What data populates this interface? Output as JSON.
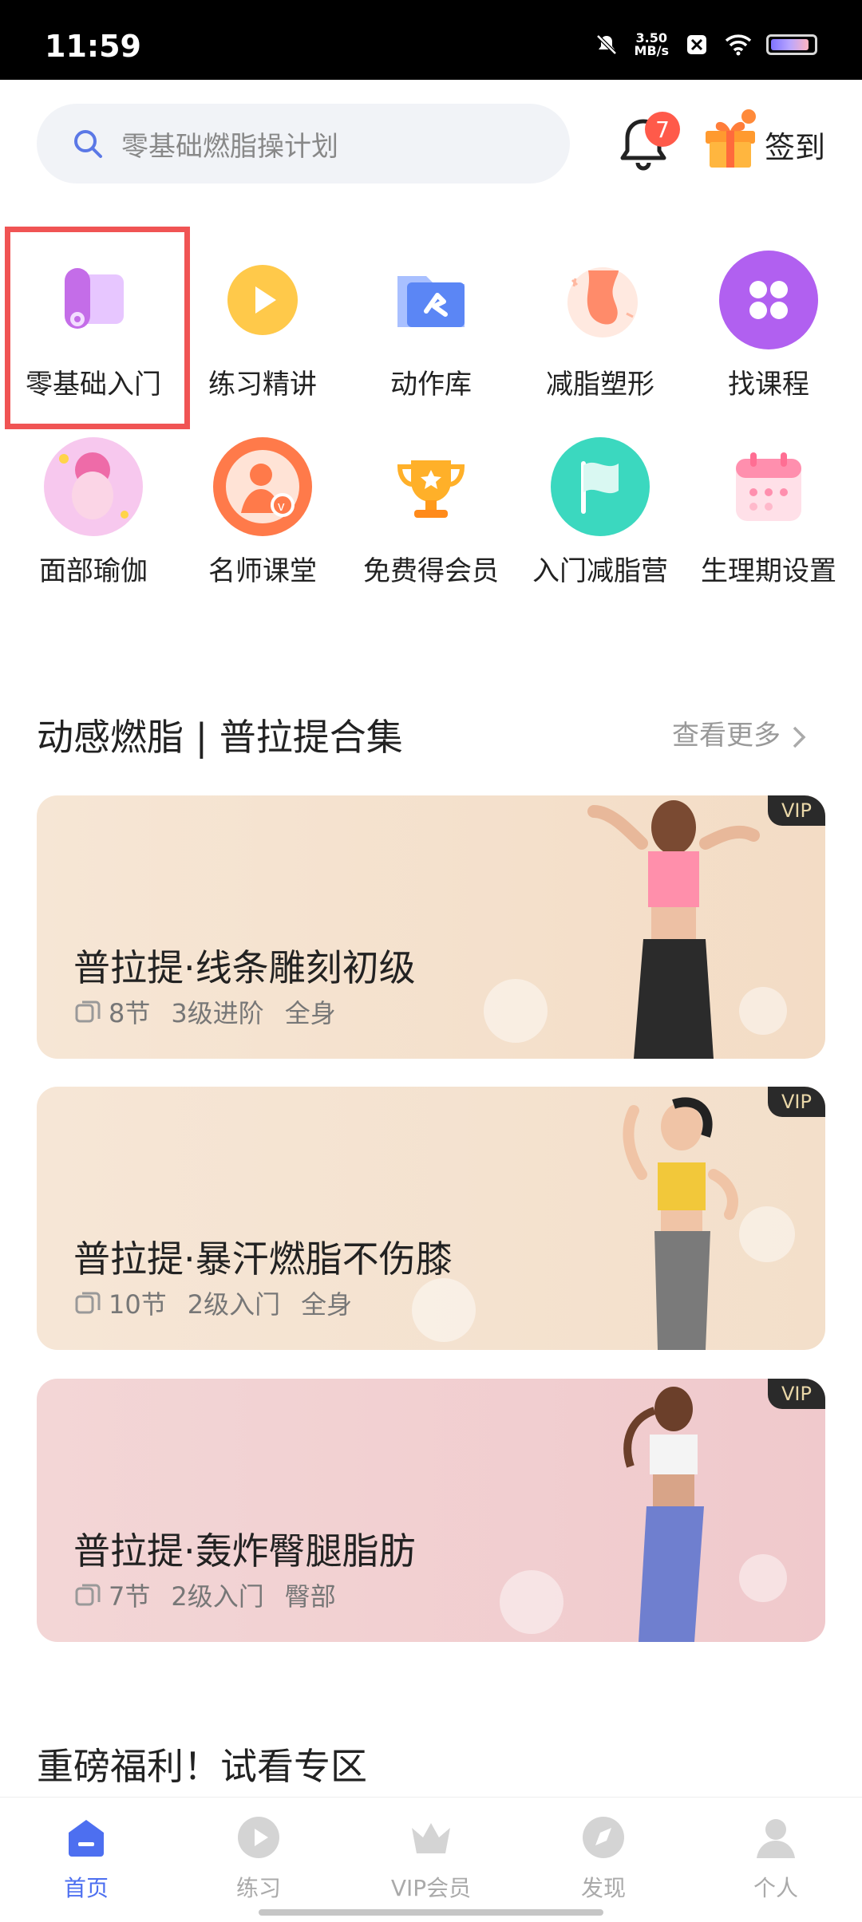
{
  "status_bar": {
    "time": "11:59",
    "net_speed_value": "3.50",
    "net_speed_unit": "MB/s"
  },
  "header": {
    "search_placeholder": "零基础燃脂操计划",
    "notification_count": "7",
    "signin_label": "签到"
  },
  "grid": [
    {
      "label": "零基础入门",
      "icon": "yoga-mat-icon"
    },
    {
      "label": "练习精讲",
      "icon": "play-icon"
    },
    {
      "label": "动作库",
      "icon": "folder-icon"
    },
    {
      "label": "减脂塑形",
      "icon": "body-shape-icon"
    },
    {
      "label": "找课程",
      "icon": "grid-icon"
    },
    {
      "label": "面部瑜伽",
      "icon": "face-yoga-icon"
    },
    {
      "label": "名师课堂",
      "icon": "teacher-icon"
    },
    {
      "label": "免费得会员",
      "icon": "trophy-icon"
    },
    {
      "label": "入门减脂营",
      "icon": "flag-icon"
    },
    {
      "label": "生理期设置",
      "icon": "calendar-icon"
    }
  ],
  "section1": {
    "title": "动感燃脂 | 普拉提合集",
    "more_label": "查看更多"
  },
  "courses": [
    {
      "title": "普拉提·线条雕刻初级",
      "lessons": "8节",
      "level": "3级进阶",
      "area": "全身",
      "badge": "VIP",
      "bg": "#f5e3cf"
    },
    {
      "title": "普拉提·暴汗燃脂不伤膝",
      "lessons": "10节",
      "level": "2级入门",
      "area": "全身",
      "badge": "VIP",
      "bg": "#f4e4d3"
    },
    {
      "title": "普拉提·轰炸臀腿脂肪",
      "lessons": "7节",
      "level": "2级入门",
      "area": "臀部",
      "badge": "VIP",
      "bg": "#f2cfd2"
    }
  ],
  "section2": {
    "title": "重磅福利！试看专区"
  },
  "bottom_nav": [
    {
      "label": "首页",
      "active": true
    },
    {
      "label": "练习",
      "active": false
    },
    {
      "label": "VIP会员",
      "active": false
    },
    {
      "label": "发现",
      "active": false
    },
    {
      "label": "个人",
      "active": false
    }
  ],
  "colors": {
    "accent": "#4d6ff0",
    "badge_red": "#ff5a4a",
    "highlight": "#f05454"
  }
}
